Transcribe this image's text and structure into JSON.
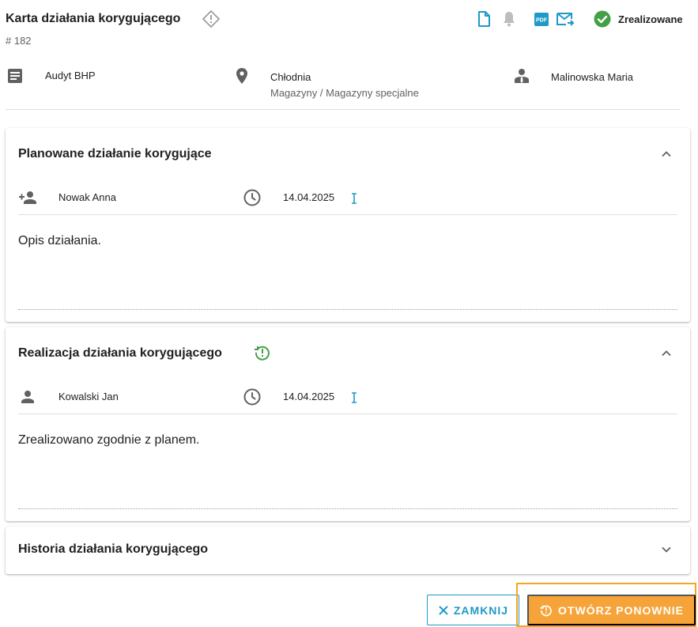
{
  "header": {
    "title": "Karta działania korygującego",
    "record_number": "# 182",
    "status_text": "Zrealizowane",
    "icons": [
      "document-icon",
      "bell-icon",
      "pdf-icon",
      "email-forward-icon",
      "status-check-icon"
    ],
    "pdf_label": "PDF"
  },
  "meta": {
    "source": "Audyt BHP",
    "location": "Chłodnia",
    "location_path": "Magazyny / Magazyny specjalne",
    "responsible": "Malinowska Maria"
  },
  "planned": {
    "title": "Planowane działanie korygujące",
    "assignee": "Nowak Anna",
    "date": "14.04.2025",
    "description": "Opis działania."
  },
  "realization": {
    "title": "Realizacja działania korygującego",
    "assignee": "Kowalski Jan",
    "date": "14.04.2025",
    "description": "Zrealizowano zgodnie z planem."
  },
  "history": {
    "title": "Historia działania korygującego"
  },
  "actions": {
    "close_label": "ZAMKNIJ",
    "reopen_label": "OTWÓRZ PONOWNIE"
  },
  "colors": {
    "accent": "#1e9ac6",
    "success": "#43a047",
    "warning": "#f6a43a",
    "icon_grey": "#616161"
  }
}
